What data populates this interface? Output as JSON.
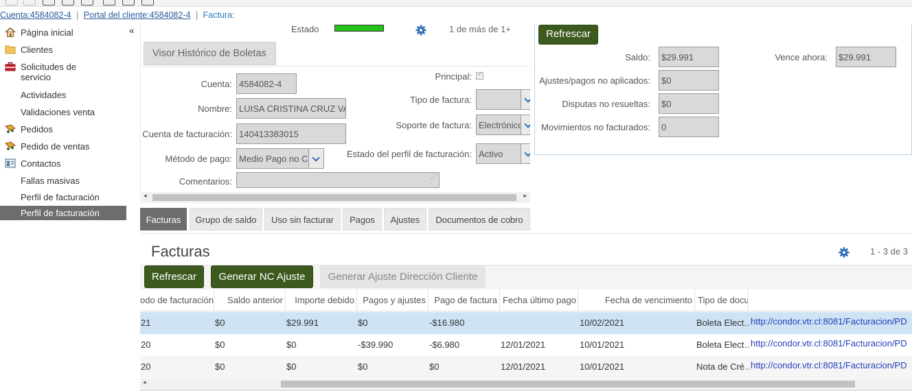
{
  "breadcrumb": {
    "items": [
      "Cuenta:4584082-4",
      "Portal del cliente:4584082-4",
      "Factura:"
    ],
    "separator": "|"
  },
  "sidebar": {
    "collapse": "«",
    "items": [
      {
        "label": "Página inicial",
        "icon": "home-icon"
      },
      {
        "label": "Clientes",
        "icon": "folder-icon"
      },
      {
        "label": "Solicitudes de servicio",
        "icon": "toolbox-icon"
      },
      {
        "label": "Actividades",
        "icon": ""
      },
      {
        "label": "Validaciones venta",
        "icon": ""
      },
      {
        "label": "Pedidos",
        "icon": "order-icon"
      },
      {
        "label": "Pedido de ventas",
        "icon": "order-icon"
      },
      {
        "label": "Contactos",
        "icon": "contacts-icon"
      },
      {
        "label": "Fallas masivas",
        "icon": ""
      },
      {
        "label": "Perfil de facturación",
        "icon": ""
      },
      {
        "label": "Perfil de facturación",
        "icon": ""
      }
    ]
  },
  "form": {
    "estado_label": "Estado",
    "pager": "1 de más de 1+",
    "historic_button": "Visor Histórico de Boletas",
    "cuenta_label": "Cuenta:",
    "cuenta_value": "4584082-4",
    "nombre_label": "Nombre:",
    "nombre_value": "LUISA CRISTINA CRUZ VA",
    "cuenta_fact_label": "Cuenta de facturación:",
    "cuenta_fact_value": "140413383015",
    "metodo_label": "Método de pago:",
    "metodo_value": "Medio Pago no C",
    "comentarios_label": "Comentarios:",
    "principal_label": "Principal:",
    "tipo_factura_label": "Tipo de factura:",
    "tipo_factura_value": "",
    "soporte_label": "Soporte de factura:",
    "soporte_value": "Electrónico",
    "estado_perfil_label": "Estado del perfil de facturación:",
    "estado_perfil_value": "Activo"
  },
  "tabs": [
    "Facturas",
    "Grupo de saldo",
    "Uso sin facturar",
    "Pagos",
    "Ajustes",
    "Documentos de cobro"
  ],
  "summary": {
    "refresh": "Refrescar",
    "saldo_label": "Saldo:",
    "saldo_value": "$29.991",
    "vence_label": "Vence ahora:",
    "vence_value": "$29.991",
    "ajustes_label": "Ajustes/pagos no aplicados:",
    "ajustes_value": "$0",
    "disputas_label": "Disputas no resueltas:",
    "disputas_value": "$0",
    "movimientos_label": "Movimientos no facturados:",
    "movimientos_value": "0"
  },
  "facturas": {
    "title": "Facturas",
    "pager": "1 - 3 de 3",
    "btn_refresh": "Refrescar",
    "btn_nc": "Generar NC Ajuste",
    "btn_ajuste": "Generar Ajuste Dirección Cliente",
    "columns": [
      "odo de facturación",
      "Saldo anterior",
      "Importe debido",
      "Pagos y ajustes",
      "Pago de factura",
      "Fecha último pago",
      "Fecha de vencimiento",
      "Tipo de docu",
      ""
    ],
    "rows": [
      [
        "21",
        "$0",
        "$29.991",
        "$0",
        "-$16.980",
        "",
        "10/02/2021",
        "Boleta Elect…",
        "http://condor.vtr.cl:8081/Facturacion/PD"
      ],
      [
        "20",
        "$0",
        "$0",
        "-$39.990",
        "-$6.980",
        "12/01/2021",
        "10/01/2021",
        "Boleta Elect…",
        "http://condor.vtr.cl:8081/Facturacion/PD"
      ],
      [
        "20",
        "$0",
        "$0",
        "$0",
        "$0",
        "12/01/2021",
        "10/01/2021",
        "Nota de Cré…",
        "http://condor.vtr.cl:8081/Facturacion/PD"
      ]
    ]
  },
  "colors": {
    "green_button": "#3c5a1e",
    "status_bar": "#22c41a",
    "selected_row": "#cfe3f4",
    "active_nav": "#6d6d6d",
    "link": "#1f3fb8"
  }
}
